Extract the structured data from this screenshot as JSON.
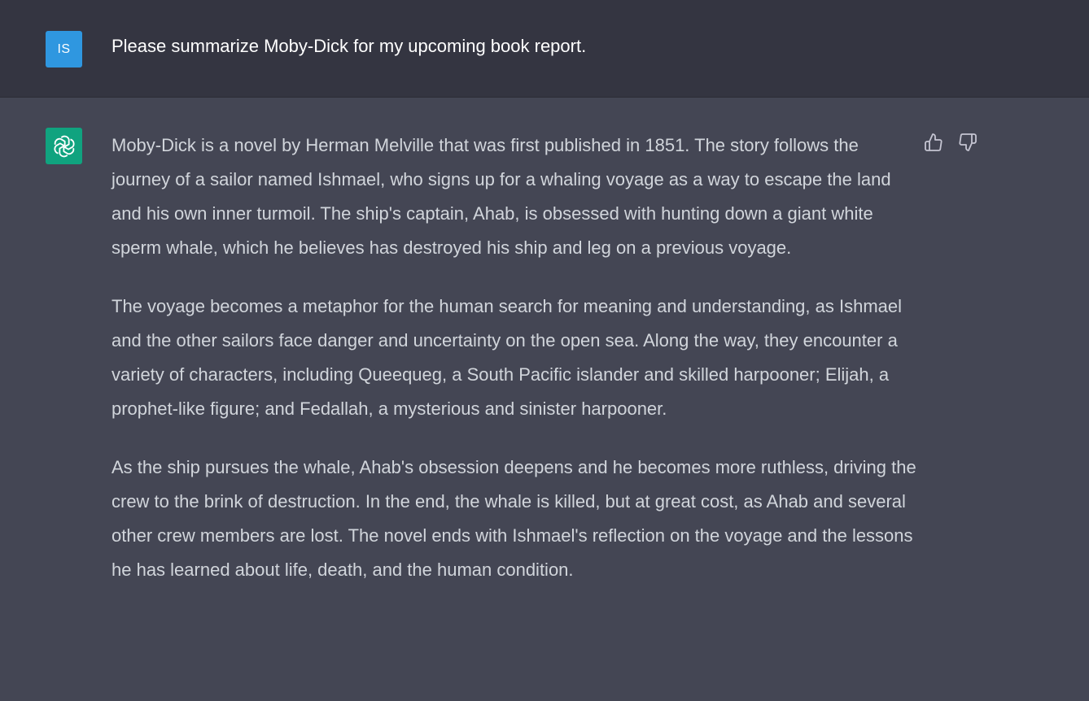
{
  "user": {
    "avatar_initials": "IS",
    "avatar_color": "#2f97e0",
    "message": "Please summarize Moby-Dick for my upcoming book report."
  },
  "assistant": {
    "avatar_icon": "openai-logo-icon",
    "avatar_color": "#10a37f",
    "paragraphs": [
      "Moby-Dick is a novel by Herman Melville that was first published in 1851. The story follows the journey of a sailor named Ishmael, who signs up for a whaling voyage as a way to escape the land and his own inner turmoil. The ship's captain, Ahab, is obsessed with hunting down a giant white sperm whale, which he believes has destroyed his ship and leg on a previous voyage.",
      "The voyage becomes a metaphor for the human search for meaning and understanding, as Ishmael and the other sailors face danger and uncertainty on the open sea. Along the way, they encounter a variety of characters, including Queequeg, a South Pacific islander and skilled harpooner; Elijah, a prophet-like figure; and Fedallah, a mysterious and sinister harpooner.",
      "As the ship pursues the whale, Ahab's obsession deepens and he becomes more ruthless, driving the crew to the brink of destruction. In the end, the whale is killed, but at great cost, as Ahab and several other crew members are lost. The novel ends with Ishmael's reflection on the voyage and the lessons he has learned about life, death, and the human condition."
    ],
    "feedback_icons": [
      "thumbs-up-icon",
      "thumbs-down-icon"
    ]
  },
  "colors": {
    "user_row_bg": "#343541",
    "assistant_row_bg": "#444654",
    "assistant_text": "#d1d5db",
    "user_text": "#ffffff"
  }
}
